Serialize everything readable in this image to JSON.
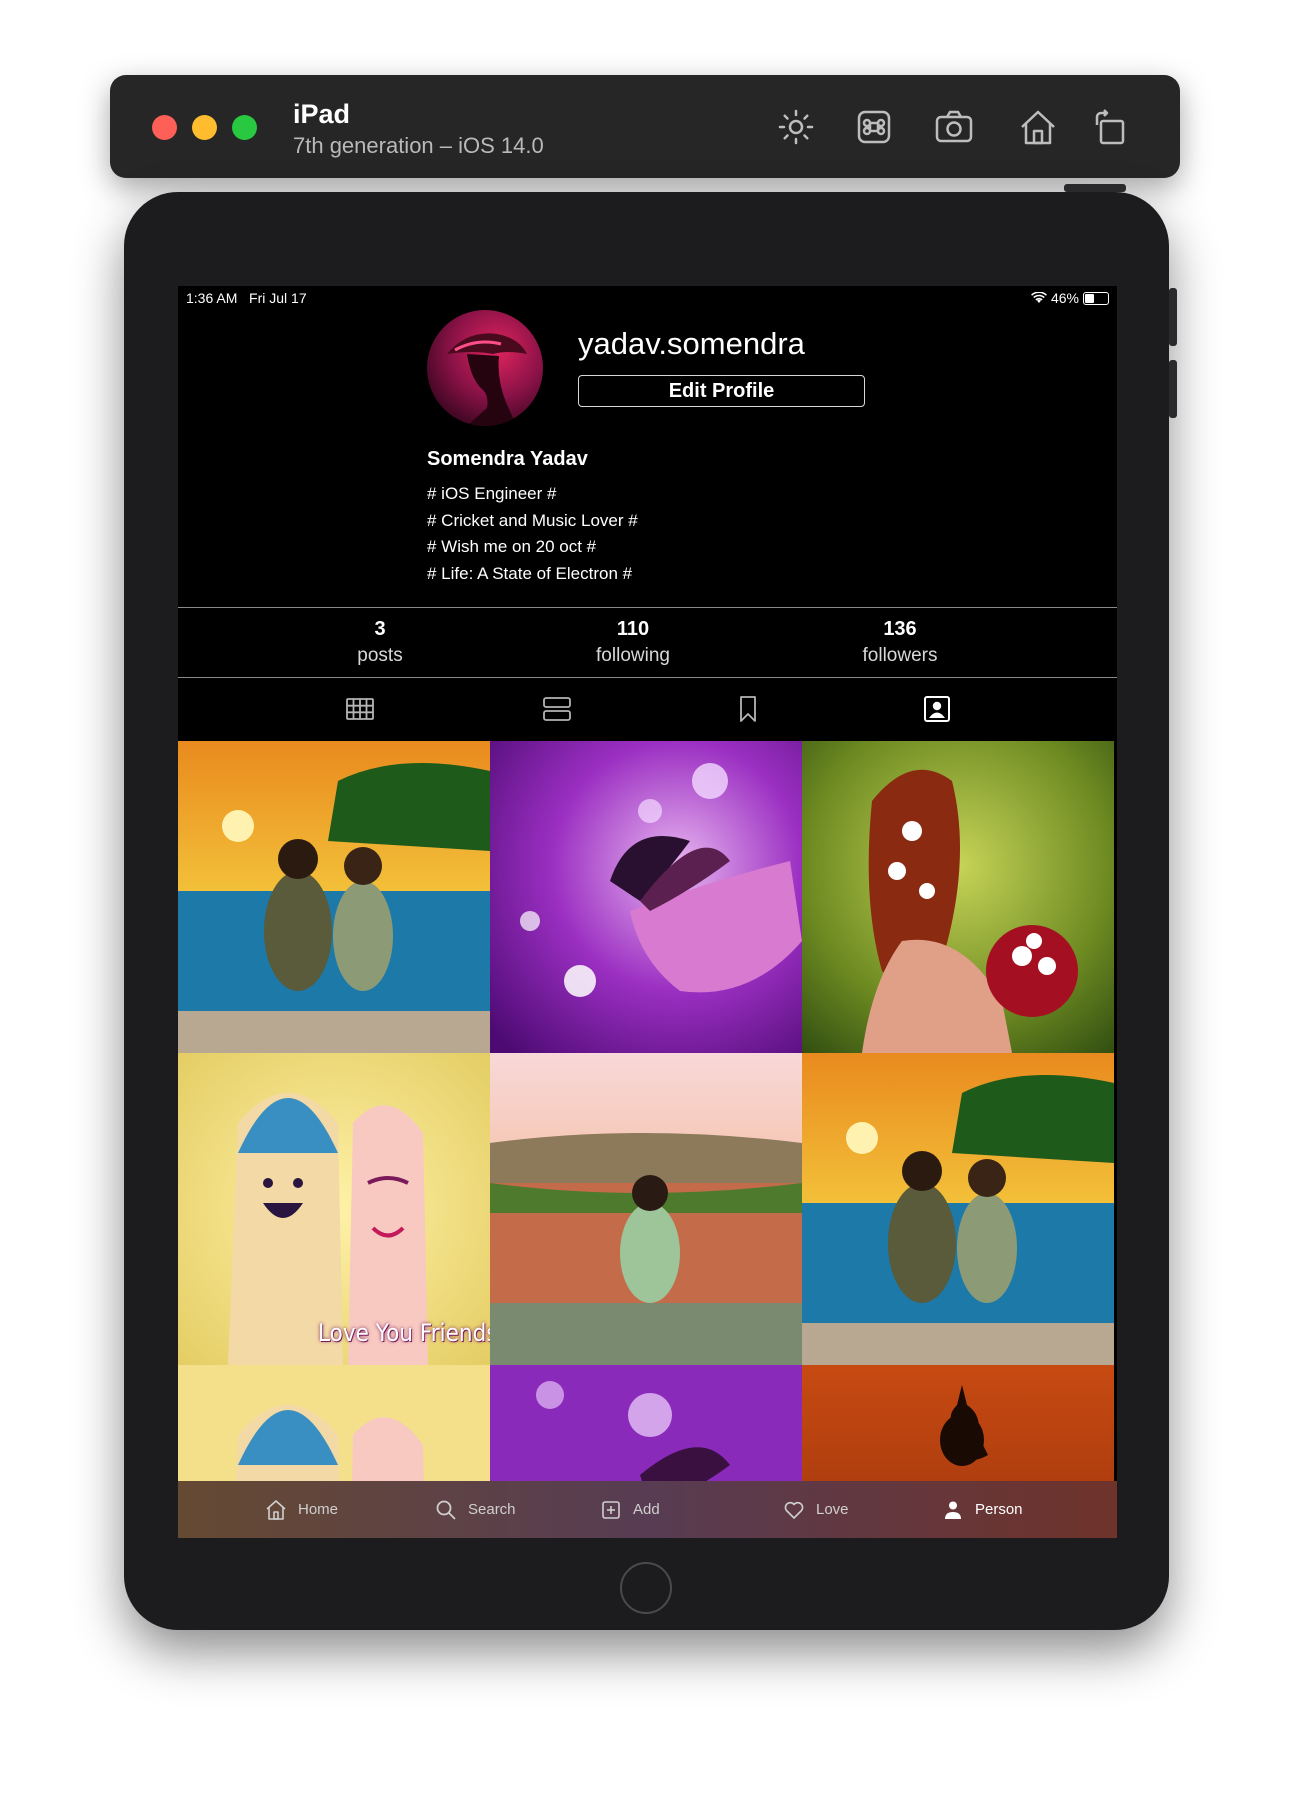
{
  "simulator": {
    "title": "iPad",
    "subtitle": "7th generation – iOS 14.0",
    "toolbar_icons": [
      "brightness-icon",
      "command-icon",
      "screenshot-icon",
      "home-icon",
      "rotate-icon"
    ]
  },
  "status_bar": {
    "time": "1:36 AM",
    "date": "Fri Jul 17",
    "battery": "46%",
    "battery_level": 0.46
  },
  "profile": {
    "username": "yadav.somendra",
    "edit_profile_label": "Edit Profile",
    "display_name": "Somendra Yadav",
    "bio": [
      "# iOS Engineer #",
      "# Cricket and Music Lover #",
      "# Wish me on 20 oct #",
      "# Life: A State of Electron #"
    ]
  },
  "stats": [
    {
      "count": "3",
      "label": "posts"
    },
    {
      "count": "110",
      "label": "following"
    },
    {
      "count": "136",
      "label": "followers"
    }
  ],
  "view_tabs": [
    "grid-icon",
    "list-icon",
    "bookmark-icon",
    "tagged-icon"
  ],
  "active_view_tab": "tagged-icon",
  "photo_overlay_text": "Love You Friends",
  "tab_bar": [
    {
      "label": "Home",
      "icon": "home-icon"
    },
    {
      "label": "Search",
      "icon": "search-icon"
    },
    {
      "label": "Add",
      "icon": "add-icon"
    },
    {
      "label": "Love",
      "icon": "heart-icon"
    },
    {
      "label": "Person",
      "icon": "person-icon"
    }
  ],
  "active_tab": "Person",
  "colors": {
    "close": "#fe5f57",
    "minimize": "#febc2e",
    "zoom": "#28c840",
    "screen_bg": "#000000"
  }
}
